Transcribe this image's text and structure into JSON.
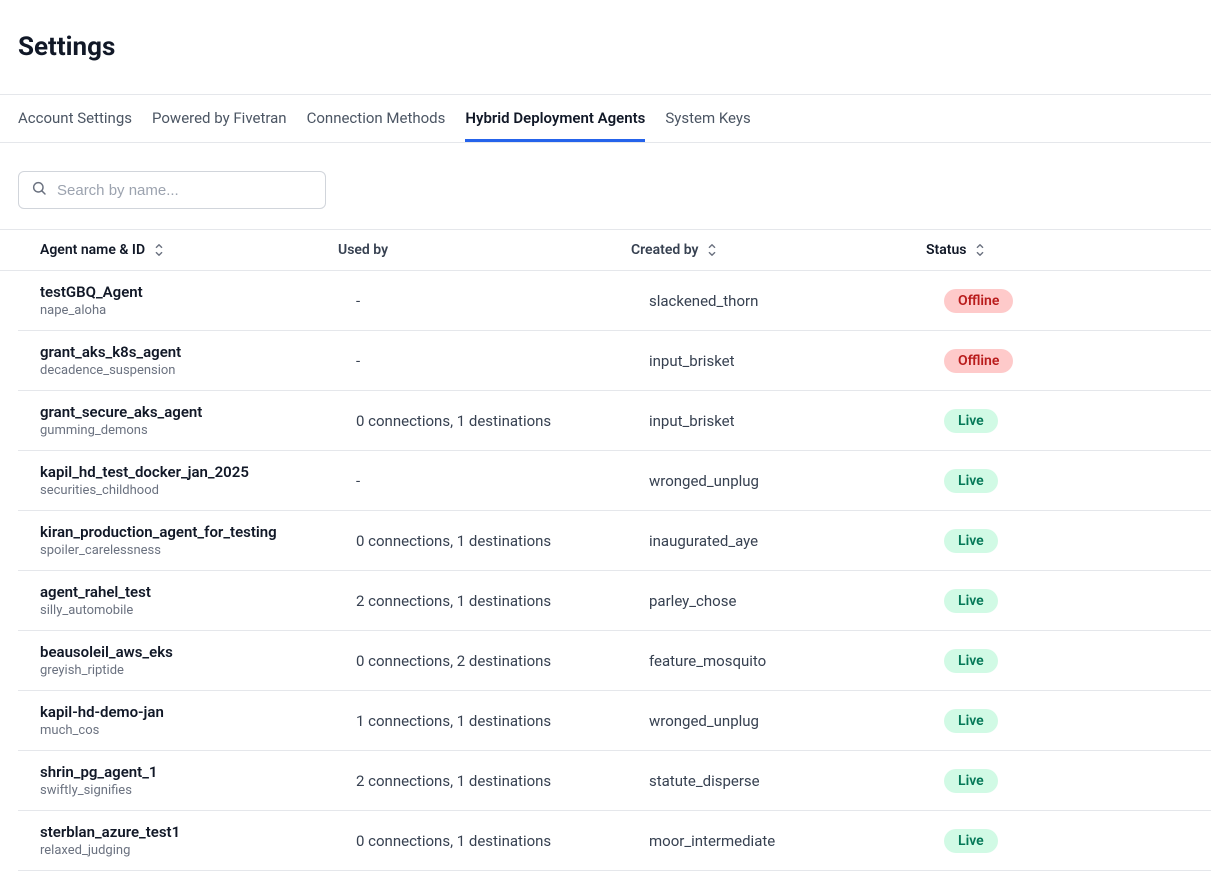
{
  "pageTitle": "Settings",
  "tabs": [
    {
      "label": "Account Settings",
      "active": false
    },
    {
      "label": "Powered by Fivetran",
      "active": false
    },
    {
      "label": "Connection Methods",
      "active": false
    },
    {
      "label": "Hybrid Deployment Agents",
      "active": true
    },
    {
      "label": "System Keys",
      "active": false
    }
  ],
  "search": {
    "placeholder": "Search by name..."
  },
  "table": {
    "columns": {
      "name": "Agent name & ID",
      "usedBy": "Used by",
      "createdBy": "Created by",
      "status": "Status"
    },
    "rows": [
      {
        "name": "testGBQ_Agent",
        "id": "nape_aloha",
        "usedBy": "-",
        "createdBy": "slackened_thorn",
        "status": "Offline"
      },
      {
        "name": "grant_aks_k8s_agent",
        "id": "decadence_suspension",
        "usedBy": "-",
        "createdBy": "input_brisket",
        "status": "Offline"
      },
      {
        "name": "grant_secure_aks_agent",
        "id": "gumming_demons",
        "usedBy": "0 connections, 1 destinations",
        "createdBy": "input_brisket",
        "status": "Live"
      },
      {
        "name": "kapil_hd_test_docker_jan_2025",
        "id": "securities_childhood",
        "usedBy": "-",
        "createdBy": "wronged_unplug",
        "status": "Live"
      },
      {
        "name": "kiran_production_agent_for_testing",
        "id": "spoiler_carelessness",
        "usedBy": "0 connections, 1 destinations",
        "createdBy": "inaugurated_aye",
        "status": "Live"
      },
      {
        "name": "agent_rahel_test",
        "id": "silly_automobile",
        "usedBy": "2 connections, 1 destinations",
        "createdBy": "parley_chose",
        "status": "Live"
      },
      {
        "name": "beausoleil_aws_eks",
        "id": "greyish_riptide",
        "usedBy": "0 connections, 2 destinations",
        "createdBy": "feature_mosquito",
        "status": "Live"
      },
      {
        "name": "kapil-hd-demo-jan",
        "id": "much_cos",
        "usedBy": "1 connections, 1 destinations",
        "createdBy": "wronged_unplug",
        "status": "Live"
      },
      {
        "name": "shrin_pg_agent_1",
        "id": "swiftly_signifies",
        "usedBy": "2 connections, 1 destinations",
        "createdBy": "statute_disperse",
        "status": "Live"
      },
      {
        "name": "sterblan_azure_test1",
        "id": "relaxed_judging",
        "usedBy": "0 connections, 1 destinations",
        "createdBy": "moor_intermediate",
        "status": "Live"
      }
    ]
  }
}
